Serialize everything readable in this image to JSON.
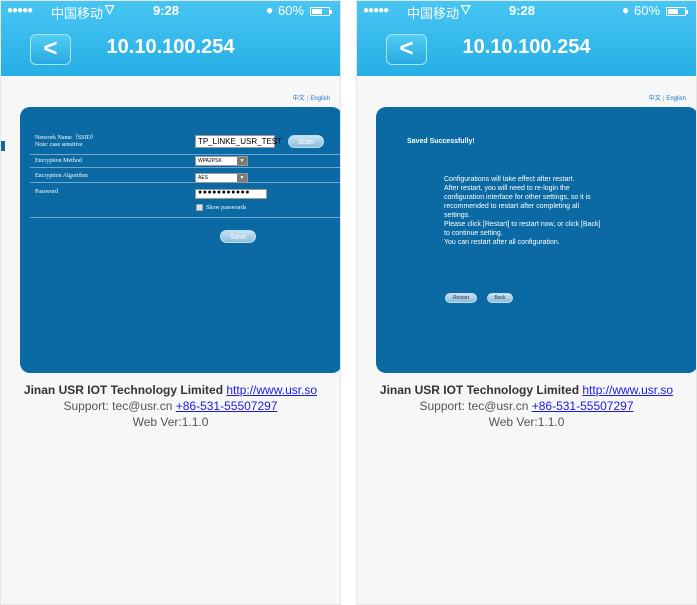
{
  "status_bar": {
    "signal": "●●●●●",
    "carrier": "中国移动",
    "time": "9:28",
    "battery": "60%"
  },
  "nav": {
    "back_label": "<",
    "title": "10.10.100.254"
  },
  "language": {
    "chinese": "中文",
    "separator": "|",
    "english": "English"
  },
  "form": {
    "ssid_label": "Network Name（SSID）",
    "ssid_note": "Note: case sensitive",
    "ssid_value": "TP_LINKE_USR_TEST",
    "scan_label": "Scan",
    "encryption_method_label": "Encryption Method",
    "encryption_method_value": "WPA2PSK",
    "encryption_algorithm_label": "Encryption Algorithm",
    "encryption_algorithm_value": "AES",
    "password_label": "Password",
    "password_value": "●●●●●●●●●●●",
    "show_passwords_label": "Show passwords",
    "save_label": "Save"
  },
  "saved": {
    "title": "Saved Successfully!",
    "message_lines": [
      "Configurations will take effect after restart.",
      "After restart, you will need to re-login the",
      "configuration interface for other settings, so it is",
      "recommended to restart after completing all",
      "settings.",
      "Please click [Restart] to restart now, or click [Back]",
      "to continue setting.",
      "You can restart after all configuration."
    ],
    "restart_label": "Restart",
    "back_label": "Back"
  },
  "footer": {
    "company": "Jinan USR IOT Technology Limited",
    "website": "http://www.usr.so",
    "support_prefix": "Support: tec@usr.cn",
    "phone": "+86-531-55507297",
    "version": "Web Ver:1.1.0"
  }
}
